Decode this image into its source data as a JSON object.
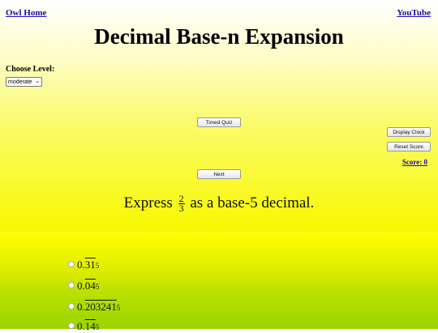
{
  "nav": {
    "owl_home": "Owl Home",
    "youtube": "YouTube"
  },
  "title": "Decimal Base-n Expansion",
  "level": {
    "label": "Choose Level:",
    "selected": "moderate"
  },
  "buttons": {
    "timed_quiz": "Timed Quiz",
    "next": "Next",
    "display_clock": "Display Clock",
    "reset_score": "Reset Score"
  },
  "score": "Score: 0",
  "question": {
    "prefix": "Express",
    "numerator": "2",
    "denominator": "3",
    "suffix": "as a base-5 decimal."
  },
  "options": [
    {
      "lead": "0.",
      "repeat": "31",
      "base": "5"
    },
    {
      "lead": "0.",
      "repeat": "04",
      "base": "5"
    },
    {
      "lead": "0.",
      "repeat": "203241",
      "base": "5"
    },
    {
      "lead": "0.",
      "repeat": "14",
      "base": "5"
    }
  ]
}
